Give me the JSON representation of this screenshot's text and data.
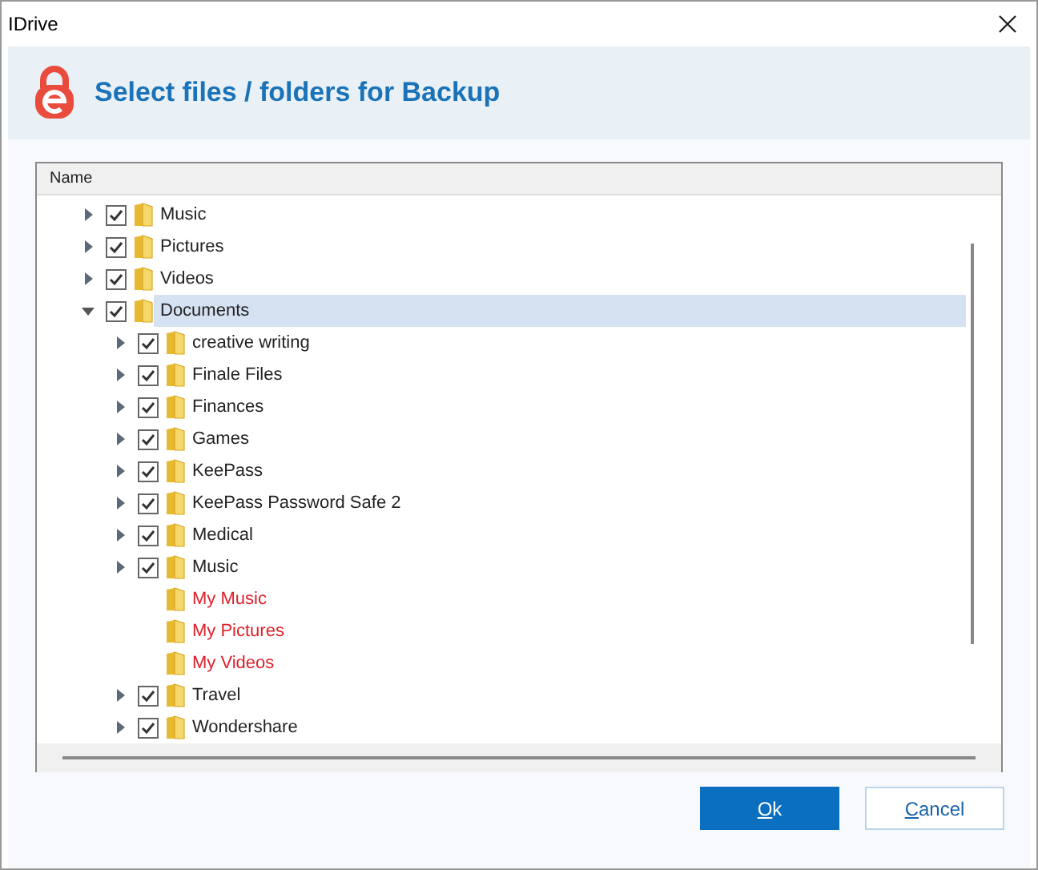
{
  "window": {
    "title": "IDrive"
  },
  "header": {
    "title": "Select files / folders for Backup"
  },
  "tree": {
    "column": "Name",
    "nodes": [
      {
        "label": "Music",
        "kind": "folder",
        "checked": true,
        "expanded": false,
        "selected": false
      },
      {
        "label": "Pictures",
        "kind": "folder",
        "checked": true,
        "expanded": false,
        "selected": false
      },
      {
        "label": "Videos",
        "kind": "folder",
        "checked": true,
        "expanded": false,
        "selected": false
      },
      {
        "label": "Documents",
        "kind": "folder",
        "checked": true,
        "expanded": true,
        "selected": true,
        "children": [
          {
            "label": "creative writing",
            "kind": "folder",
            "checked": true,
            "expanded": false,
            "selected": false
          },
          {
            "label": "Finale Files",
            "kind": "folder",
            "checked": true,
            "expanded": false,
            "selected": false
          },
          {
            "label": "Finances",
            "kind": "folder",
            "checked": true,
            "expanded": false,
            "selected": false
          },
          {
            "label": "Games",
            "kind": "folder",
            "checked": true,
            "expanded": false,
            "selected": false
          },
          {
            "label": "KeePass",
            "kind": "folder",
            "checked": true,
            "expanded": false,
            "selected": false
          },
          {
            "label": "KeePass Password Safe 2",
            "kind": "folder",
            "checked": true,
            "expanded": false,
            "selected": false
          },
          {
            "label": "Medical",
            "kind": "folder",
            "checked": true,
            "expanded": false,
            "selected": false
          },
          {
            "label": "Music",
            "kind": "folder",
            "checked": true,
            "expanded": false,
            "selected": false
          },
          {
            "label": "My Music",
            "kind": "missing",
            "selected": false
          },
          {
            "label": "My Pictures",
            "kind": "missing",
            "selected": false
          },
          {
            "label": "My Videos",
            "kind": "missing",
            "selected": false
          },
          {
            "label": "Travel",
            "kind": "folder",
            "checked": true,
            "expanded": false,
            "selected": false
          },
          {
            "label": "Wondershare",
            "kind": "folder",
            "checked": true,
            "expanded": false,
            "selected": false
          }
        ]
      }
    ]
  },
  "buttons": [
    {
      "label": "Ok",
      "kind": "primary"
    },
    {
      "label": "Cancel",
      "kind": "secondary"
    }
  ]
}
